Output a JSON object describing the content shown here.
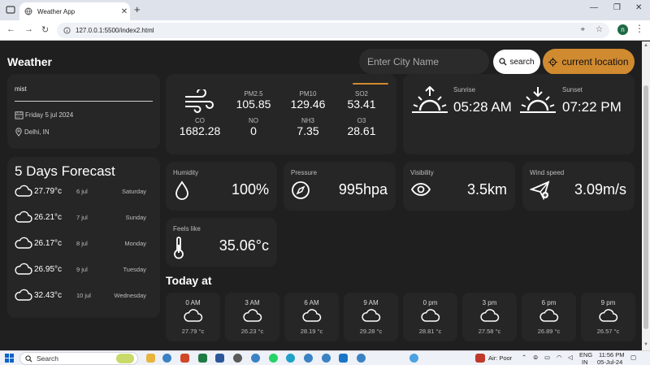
{
  "browser": {
    "tab_title": "Weather App",
    "url": "127.0.0.1:5500/index2.html",
    "profile_initial": "n"
  },
  "header": {
    "logo": "Weather",
    "city_placeholder": "Enter City Name",
    "search_label": "search",
    "location_label": "current location"
  },
  "current": {
    "description": "mist",
    "date": "Friday 5 jul 2024",
    "location": "Delhi, IN"
  },
  "forecast": {
    "title": "5 Days Forecast",
    "days": [
      {
        "temp": "27.79°c",
        "date": "6 jul",
        "day": "Saturday"
      },
      {
        "temp": "26.21°c",
        "date": "7 jul",
        "day": "Sunday"
      },
      {
        "temp": "26.17°c",
        "date": "8 jul",
        "day": "Monday"
      },
      {
        "temp": "26.95°c",
        "date": "9 jul",
        "day": "Tuesday"
      },
      {
        "temp": "32.43°c",
        "date": "10 jul",
        "day": "Wednesday"
      }
    ]
  },
  "air_quality": {
    "pm2_5": {
      "label": "PM2.5",
      "value": "105.85"
    },
    "pm10": {
      "label": "PM10",
      "value": "129.46"
    },
    "so2": {
      "label": "SO2",
      "value": "53.41"
    },
    "co": {
      "label": "CO",
      "value": "1682.28"
    },
    "no": {
      "label": "NO",
      "value": "0"
    },
    "nh3": {
      "label": "NH3",
      "value": "7.35"
    },
    "o3": {
      "label": "O3",
      "value": "28.61"
    }
  },
  "sun": {
    "sunrise_label": "Sunrise",
    "sunrise_time": "05:28 AM",
    "sunset_label": "Sunset",
    "sunset_time": "07:22 PM"
  },
  "highlights": {
    "humidity": {
      "label": "Humidity",
      "value": "100%"
    },
    "pressure": {
      "label": "Pressure",
      "value": "995hpa"
    },
    "visibility": {
      "label": "Visibility",
      "value": "3.5km"
    },
    "wind_speed": {
      "label": "Wind speed",
      "value": "3.09m/s"
    },
    "feels_like": {
      "label": "Feels like",
      "value": "35.06°c"
    }
  },
  "today": {
    "title": "Today at",
    "hours": [
      {
        "time": "0 AM",
        "temp": "27.79 °c"
      },
      {
        "time": "3 AM",
        "temp": "26.23 °c"
      },
      {
        "time": "6 AM",
        "temp": "28.19 °c"
      },
      {
        "time": "9 AM",
        "temp": "29.28 °c"
      },
      {
        "time": "0 pm",
        "temp": "28.81 °c"
      },
      {
        "time": "3 pm",
        "temp": "27.58 °c"
      },
      {
        "time": "6 pm",
        "temp": "26.89 °c"
      },
      {
        "time": "9 pm",
        "temp": "26.57 °c"
      }
    ]
  },
  "taskbar": {
    "search_label": "Search",
    "air_status": "Air: Poor",
    "lang_top": "ENG",
    "lang_bottom": "IN",
    "time": "11:56 PM",
    "date": "05-Jul-24"
  },
  "colors": {
    "accent": "#d08a2f",
    "card": "#262626",
    "background": "#1f1f1f"
  }
}
